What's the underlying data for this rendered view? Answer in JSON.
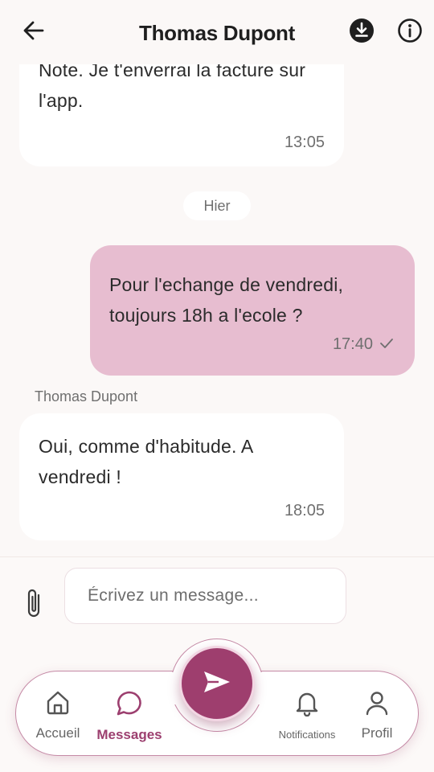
{
  "header": {
    "title": "Thomas Dupont"
  },
  "messages": [
    {
      "direction": "incoming",
      "text": "Note. Je t'enverrai la facture sur l'app.",
      "time": "13:05"
    },
    {
      "direction": "outgoing",
      "text": "Pour l'echange de vendredi, toujours 18h a l'ecole ?",
      "time": "17:40",
      "status": "sent"
    },
    {
      "direction": "incoming",
      "sender": "Thomas Dupont",
      "text": "Oui, comme d'habitude. A vendredi !",
      "time": "18:05"
    }
  ],
  "date_separator": "Hier",
  "composer": {
    "placeholder": "Écrivez un message..."
  },
  "nav": {
    "items": [
      {
        "label": "Accueil",
        "icon": "home-icon",
        "active": false
      },
      {
        "label": "Messages",
        "icon": "chat-bubble-icon",
        "active": true
      },
      {
        "label": "Notifications",
        "icon": "bell-icon",
        "active": false
      },
      {
        "label": "Profil",
        "icon": "user-icon",
        "active": false
      }
    ]
  },
  "colors": {
    "accent": "#9e3e6e",
    "outgoing_bubble": "#e7bdd0",
    "background": "#fbf8f7"
  }
}
